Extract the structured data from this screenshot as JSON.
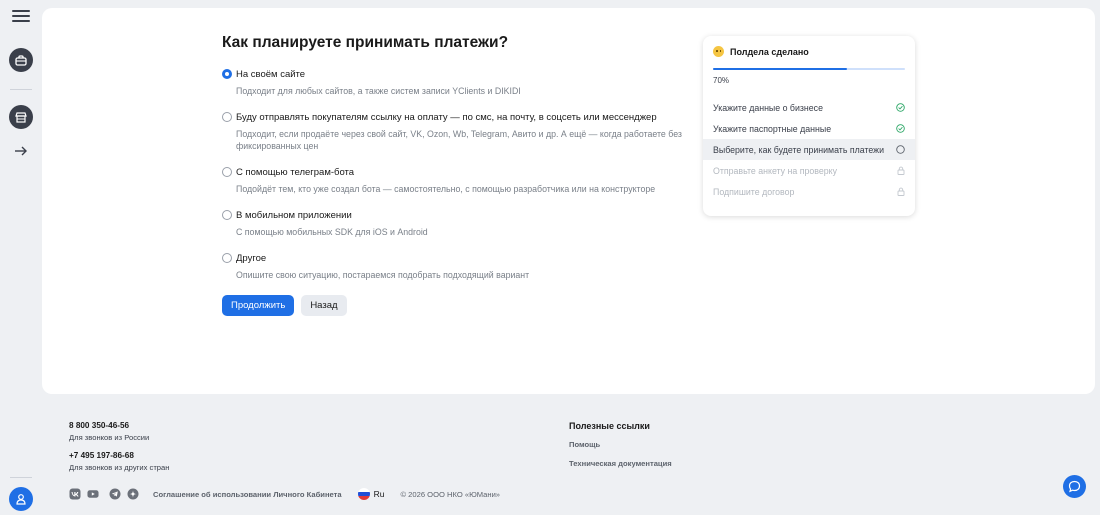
{
  "colors": {
    "accent": "#1f6fe5",
    "success": "#2aa665",
    "muted": "#7a8089",
    "background": "#eef0f3"
  },
  "rail": {
    "menu_icon": "menu-icon",
    "items": [
      {
        "icon": "briefcase-icon"
      },
      {
        "icon": "store-icon"
      },
      {
        "icon": "arrow-right-icon"
      }
    ],
    "profile_icon": "user-icon"
  },
  "form": {
    "title": "Как планируете принимать платежи?",
    "options": [
      {
        "label": "На своём сайте",
        "desc": "Подходит для любых сайтов, а также систем записи YClients и DIKIDI",
        "selected": true
      },
      {
        "label": "Буду отправлять покупателям ссылку на оплату — по смс, на почту, в соцсеть или мессенджер",
        "desc": "Подходит, если продаёте через свой сайт, VK, Ozon, Wb, Telegram, Авито и др. А ещё — когда работаете без фиксированных цен",
        "selected": false
      },
      {
        "label": "С помощью телеграм-бота",
        "desc": "Подойдёт тем, кто уже создал бота — самостоятельно, с помощью разработчика или на конструкторе",
        "selected": false
      },
      {
        "label": "В мобильном приложении",
        "desc": "С помощью мобильных SDK для iOS и Android",
        "selected": false
      },
      {
        "label": "Другое",
        "desc": "Опишите свою ситуацию, постараемся подобрать подходящий вариант",
        "selected": false
      }
    ],
    "continue_label": "Продолжить",
    "back_label": "Назад"
  },
  "progress": {
    "title": "Полдела сделано",
    "percent_label": "70%",
    "percent_value": 70,
    "steps": [
      {
        "label": "Укажите данные о бизнесе",
        "state": "done"
      },
      {
        "label": "Укажите паспортные данные",
        "state": "done"
      },
      {
        "label": "Выберите, как будете принимать платежи",
        "state": "active"
      },
      {
        "label": "Отправьте анкету на проверку",
        "state": "locked"
      },
      {
        "label": "Подпишите договор",
        "state": "locked"
      }
    ]
  },
  "footer": {
    "phone_1": "8 800 350-46-56",
    "phone_1_note": "Для звонков из России",
    "phone_2": "+7 495 197-86-68",
    "phone_2_note": "Для звонков из других стран",
    "links_title": "Полезные ссылки",
    "links": [
      "Помощь",
      "Техническая документация"
    ],
    "social_icons": [
      "vk-icon",
      "youtube-icon",
      "telegram-icon",
      "dzen-icon"
    ],
    "agreement": "Соглашение об использовании Личного Кабинета",
    "language": "Ru",
    "copyright": "© 2026 ООО НКО «ЮМани»"
  }
}
